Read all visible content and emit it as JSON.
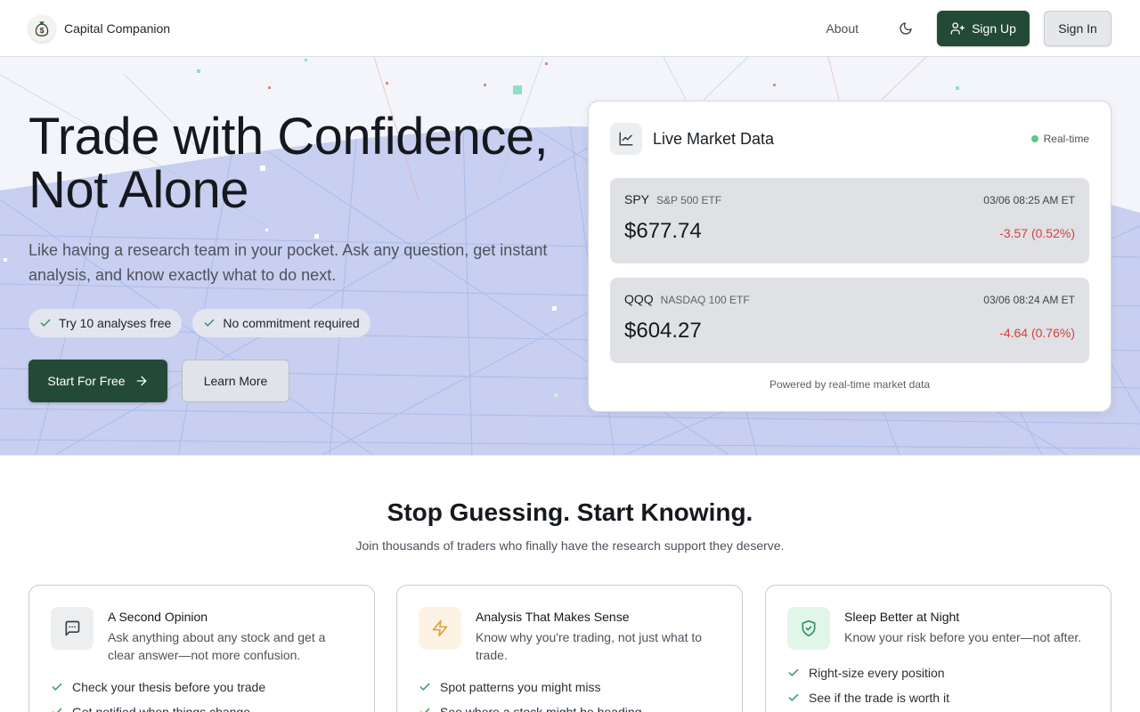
{
  "header": {
    "brand_name": "Capital Companion",
    "about_label": "About",
    "signup_label": "Sign Up",
    "signin_label": "Sign In"
  },
  "hero": {
    "title_line1": "Trade with Confidence,",
    "title_line2": "Not Alone",
    "subtitle": "Like having a research team in your pocket. Ask any question, get instant analysis, and know exactly what to do next.",
    "pills": [
      "Try 10 analyses free",
      "No commitment required"
    ],
    "start_label": "Start For Free",
    "learn_label": "Learn More"
  },
  "market": {
    "title": "Live Market Data",
    "live_label": "Real-time",
    "quotes": [
      {
        "symbol": "SPY",
        "description": "S&P 500 ETF",
        "time": "03/06 08:25 AM ET",
        "price": "$677.74",
        "change": "-3.57 (0.52%)"
      },
      {
        "symbol": "QQQ",
        "description": "NASDAQ 100 ETF",
        "time": "03/06 08:24 AM ET",
        "price": "$604.27",
        "change": "-4.64 (0.76%)"
      }
    ],
    "footer": "Powered by real-time market data"
  },
  "features": {
    "title": "Stop Guessing. Start Knowing.",
    "subtitle": "Join thousands of traders who finally have the research support they deserve.",
    "cards": [
      {
        "title": "A Second Opinion",
        "description": "Ask anything about any stock and get a clear answer—not more confusion.",
        "items": [
          "Check your thesis before you trade",
          "Get notified when things change"
        ]
      },
      {
        "title": "Analysis That Makes Sense",
        "description": "Know why you're trading, not just what to trade.",
        "items": [
          "Spot patterns you might miss",
          "See where a stock might be heading"
        ]
      },
      {
        "title": "Sleep Better at Night",
        "description": "Know your risk before you enter—not after.",
        "items": [
          "Right-size every position",
          "See if the trade is worth it"
        ]
      }
    ]
  },
  "colors": {
    "brand_green": "#234a37",
    "negative_red": "#d6403c",
    "live_green": "#5fc490",
    "chat_icon_bg": "#eceef0",
    "bolt_icon_bg": "#fdf3e4",
    "shield_icon_bg": "#e2f5e9"
  },
  "icons": {
    "logo": "money-bag-icon",
    "theme": "moon-icon",
    "signup": "user-plus-icon",
    "check": "check-icon",
    "start": "arrow-right-icon",
    "chart": "line-chart-icon",
    "cards": [
      "chat-icon",
      "lightning-icon",
      "shield-check-icon"
    ]
  }
}
